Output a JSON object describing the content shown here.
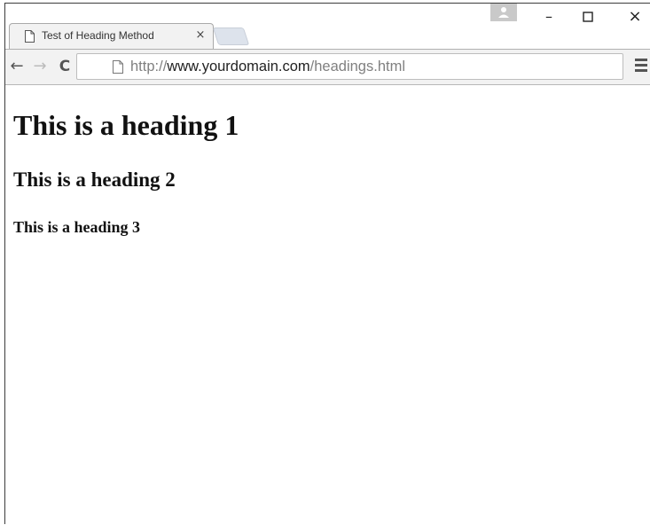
{
  "browser": {
    "tab": {
      "title": "Test of Heading Method",
      "close_glyph": "×",
      "icon": "page-icon"
    },
    "window_controls": {
      "minimize": "–",
      "maximize": "☐",
      "close": "×",
      "profile_icon": "profile-icon"
    },
    "toolbar": {
      "back_glyph": "←",
      "forward_glyph": "→",
      "reload_glyph": "C",
      "url_scheme": "http://",
      "url_host": "www.yourdomain.com",
      "url_path": "/headings.html",
      "menu_icon": "hamburger-menu-icon"
    }
  },
  "page": {
    "h1": "This is a heading 1",
    "h2": "This is a heading 2",
    "h3": "This is a heading 3"
  }
}
